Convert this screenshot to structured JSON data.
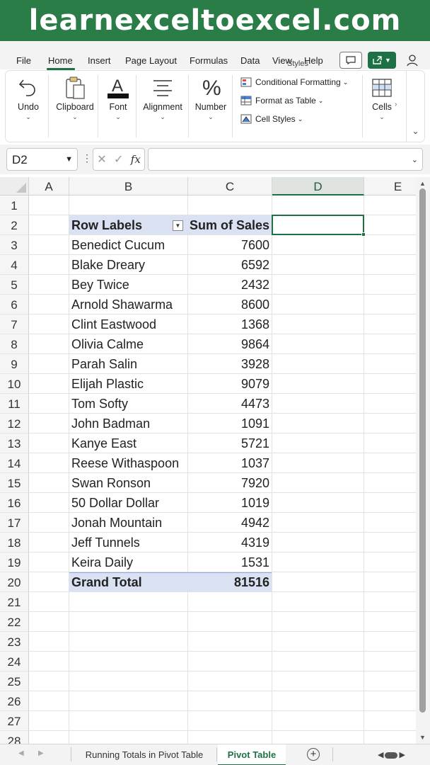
{
  "banner": {
    "text": "learnexceltoexcel.com"
  },
  "menu": {
    "items": [
      "File",
      "Home",
      "Insert",
      "Page Layout",
      "Formulas",
      "Data",
      "View",
      "Help"
    ],
    "active": "Home",
    "icons": [
      "comment-icon",
      "share-icon",
      "person-icon"
    ]
  },
  "ribbon": {
    "undo": "Undo",
    "clipboard": "Clipboard",
    "font": "Font",
    "alignment": "Alignment",
    "number": "Number",
    "conditional_formatting": "Conditional Formatting",
    "format_as_table": "Format as Table",
    "cell_styles": "Cell Styles",
    "styles_group": "Styles",
    "cells": "Cells"
  },
  "formula_bar": {
    "name_box": "D2",
    "fx_label": "fx",
    "formula_value": ""
  },
  "grid": {
    "columns": [
      "A",
      "B",
      "C",
      "D",
      "E"
    ],
    "selected_column": "D",
    "selected_cell": "D2",
    "row_numbers": [
      "1",
      "2",
      "3",
      "4",
      "5",
      "6",
      "7",
      "8",
      "9",
      "10",
      "11",
      "12",
      "13",
      "14",
      "15",
      "16",
      "17",
      "18",
      "19",
      "20",
      "21",
      "22",
      "23",
      "24",
      "25",
      "26",
      "27",
      "28"
    ],
    "pivot": {
      "header_label": "Row Labels",
      "header_value": "Sum of Sales",
      "rows": [
        {
          "label": "Benedict Cucum",
          "value": "7600"
        },
        {
          "label": "Blake Dreary",
          "value": "6592"
        },
        {
          "label": "Bey Twice",
          "value": "2432"
        },
        {
          "label": "Arnold Shawarma",
          "value": "8600"
        },
        {
          "label": "Clint Eastwood",
          "value": "1368"
        },
        {
          "label": "Olivia Calme",
          "value": "9864"
        },
        {
          "label": "Parah Salin",
          "value": "3928"
        },
        {
          "label": "Elijah Plastic",
          "value": "9079"
        },
        {
          "label": "Tom Softy",
          "value": "4473"
        },
        {
          "label": "John Badman",
          "value": "1091"
        },
        {
          "label": "Kanye East",
          "value": "5721"
        },
        {
          "label": "Reese Withaspoon",
          "value": "1037"
        },
        {
          "label": "Swan Ronson",
          "value": "7920"
        },
        {
          "label": "50 Dollar Dollar",
          "value": "1019"
        },
        {
          "label": "Jonah Mountain",
          "value": "4942"
        },
        {
          "label": "Jeff Tunnels",
          "value": "4319"
        },
        {
          "label": "Keira Daily",
          "value": "1531"
        }
      ],
      "total_label": "Grand Total",
      "total_value": "81516"
    }
  },
  "sheets": {
    "tabs": [
      "Running Totals in Pivot Table",
      "Pivot Table"
    ],
    "active": "Pivot Table"
  },
  "colors": {
    "brand_green": "#2a7d46",
    "pivot_header_fill": "#d9e1f2"
  }
}
